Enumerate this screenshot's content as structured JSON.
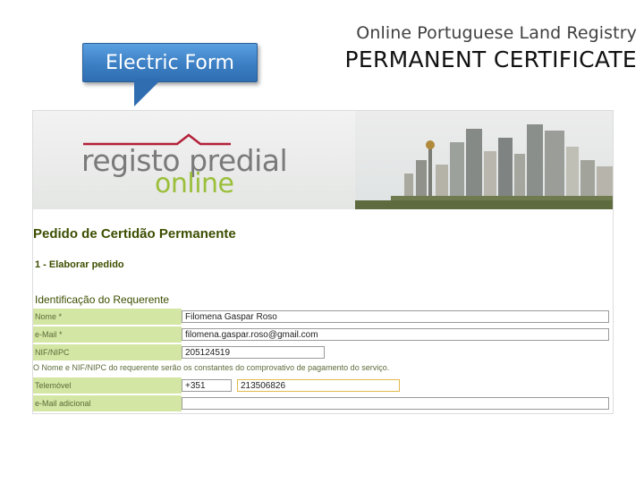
{
  "slide": {
    "subtitle": "Online Portuguese Land Registry",
    "title": "PERMANENT CERTIFICATE",
    "callout": "Electric Form"
  },
  "site": {
    "logo_line1": "registo predial",
    "logo_line2": "online"
  },
  "form": {
    "page_heading": "Pedido de Certidão Permanente",
    "step_heading": "1 - Elaborar pedido",
    "section_heading": "Identificação do Requerente",
    "fields": {
      "name_label": "Nome *",
      "name_value": "Filomena Gaspar Roso",
      "email_label": "e-Mail *",
      "email_value": "filomena.gaspar.roso@gmail.com",
      "nif_label": "NIF/NIPC",
      "nif_value": "205124519",
      "notice": "O Nome e NIF/NIPC do requerente serão os constantes do comprovativo de pagamento do serviço.",
      "phone_label": "Telemóvel",
      "phone_code": "+351",
      "phone_number": "213506826",
      "alt_email_label": "e-Mail adicional",
      "alt_email_value": ""
    }
  },
  "colors": {
    "accent_green": "#9bbf3a",
    "label_background": "#d4e6a3",
    "heading_text": "#3c4e00",
    "callout_blue": "#3c7fc4"
  }
}
